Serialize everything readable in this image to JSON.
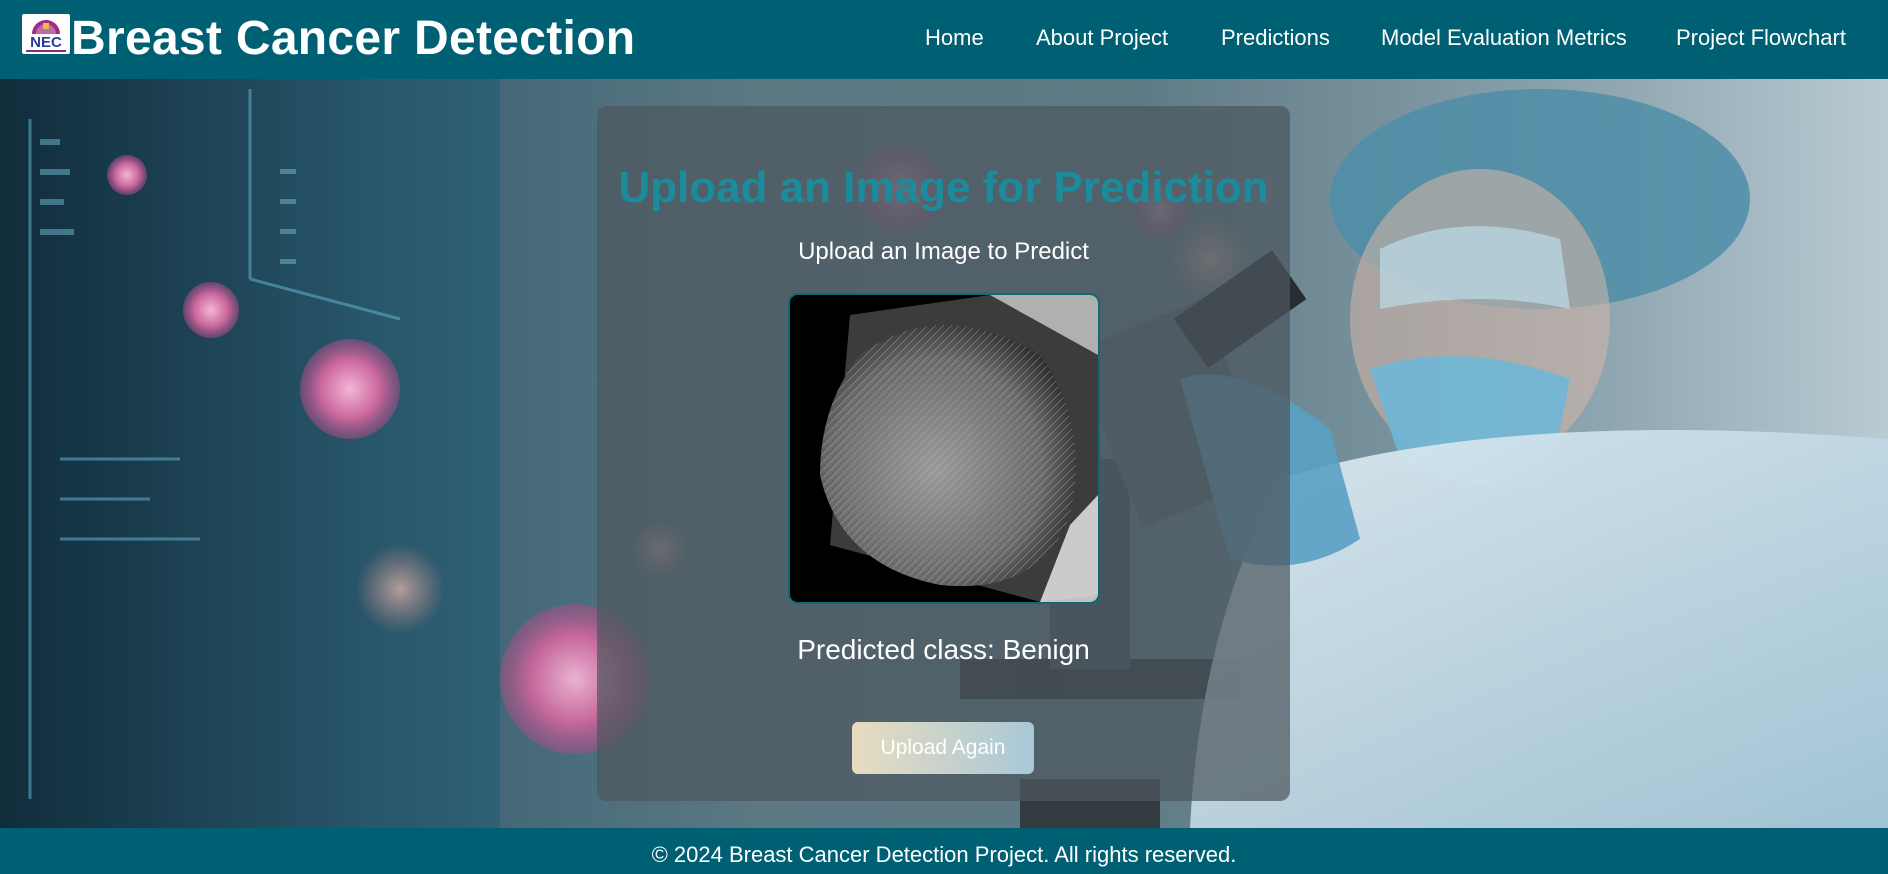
{
  "header": {
    "logo_text": "NEC",
    "title": "Breast Cancer Detection",
    "nav": [
      {
        "label": "Home"
      },
      {
        "label": "About Project"
      },
      {
        "label": "Predictions"
      },
      {
        "label": "Model Evaluation Metrics"
      },
      {
        "label": "Project Flowchart"
      }
    ]
  },
  "card": {
    "heading": "Upload an Image for Prediction",
    "subheading": "Upload an Image to Predict",
    "preview_icon": "mammogram-image",
    "result": "Predicted class: Benign",
    "upload_again_label": "Upload Again"
  },
  "footer": {
    "text": "© 2024 Breast Cancer Detection Project. All rights reserved."
  },
  "colors": {
    "header_bg": "#006073",
    "heading": "#1a8c9c",
    "card_bg": "rgba(78, 88, 94, 0.72)"
  }
}
